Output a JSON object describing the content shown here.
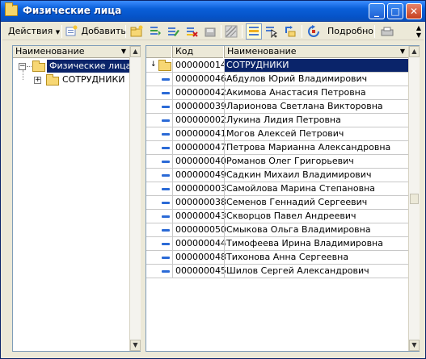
{
  "window": {
    "title": "Физические лица"
  },
  "toolbar": {
    "actions_label": "Действия",
    "add_label": "Добавить",
    "details_label": "Подробно"
  },
  "tree": {
    "header": "Наименование",
    "root_label": "Физические лица",
    "child_label": "СОТРУДНИКИ"
  },
  "grid": {
    "columns": [
      "Код",
      "Наименование"
    ],
    "group_row": {
      "code": "000000014",
      "name": "СОТРУДНИКИ"
    },
    "rows": [
      {
        "code": "000000046",
        "name": "Абдулов Юрий Владимирович"
      },
      {
        "code": "000000042",
        "name": "Акимова Анастасия Петровна"
      },
      {
        "code": "000000039",
        "name": "Ларионова Светлана Викторовна"
      },
      {
        "code": "000000002",
        "name": "Лукина  Лидия Петровна"
      },
      {
        "code": "000000041",
        "name": "Могов Алексей Петрович"
      },
      {
        "code": "000000047",
        "name": "Петрова Марианна Александровна"
      },
      {
        "code": "000000040",
        "name": "Романов Олег Григорьевич"
      },
      {
        "code": "000000049",
        "name": "Садкин Михаил Владимирович"
      },
      {
        "code": "000000003",
        "name": "Самойлова Марина Степановна"
      },
      {
        "code": "000000038",
        "name": "Семенов Геннадий Сергеевич"
      },
      {
        "code": "000000043",
        "name": "Скворцов Павел Андреевич"
      },
      {
        "code": "000000050",
        "name": "Смыкова Ольга Владимировна"
      },
      {
        "code": "000000044",
        "name": "Тимофеева Ирина Владимировна"
      },
      {
        "code": "000000048",
        "name": "Тихонова Анна Сергеевна"
      },
      {
        "code": "000000045",
        "name": "Шилов Сергей Александрович"
      }
    ]
  },
  "colors": {
    "titlebar": "#0a5fd8",
    "selection": "#0a246a",
    "folder": "#f7d774",
    "item_marker": "#2b6ad6"
  }
}
